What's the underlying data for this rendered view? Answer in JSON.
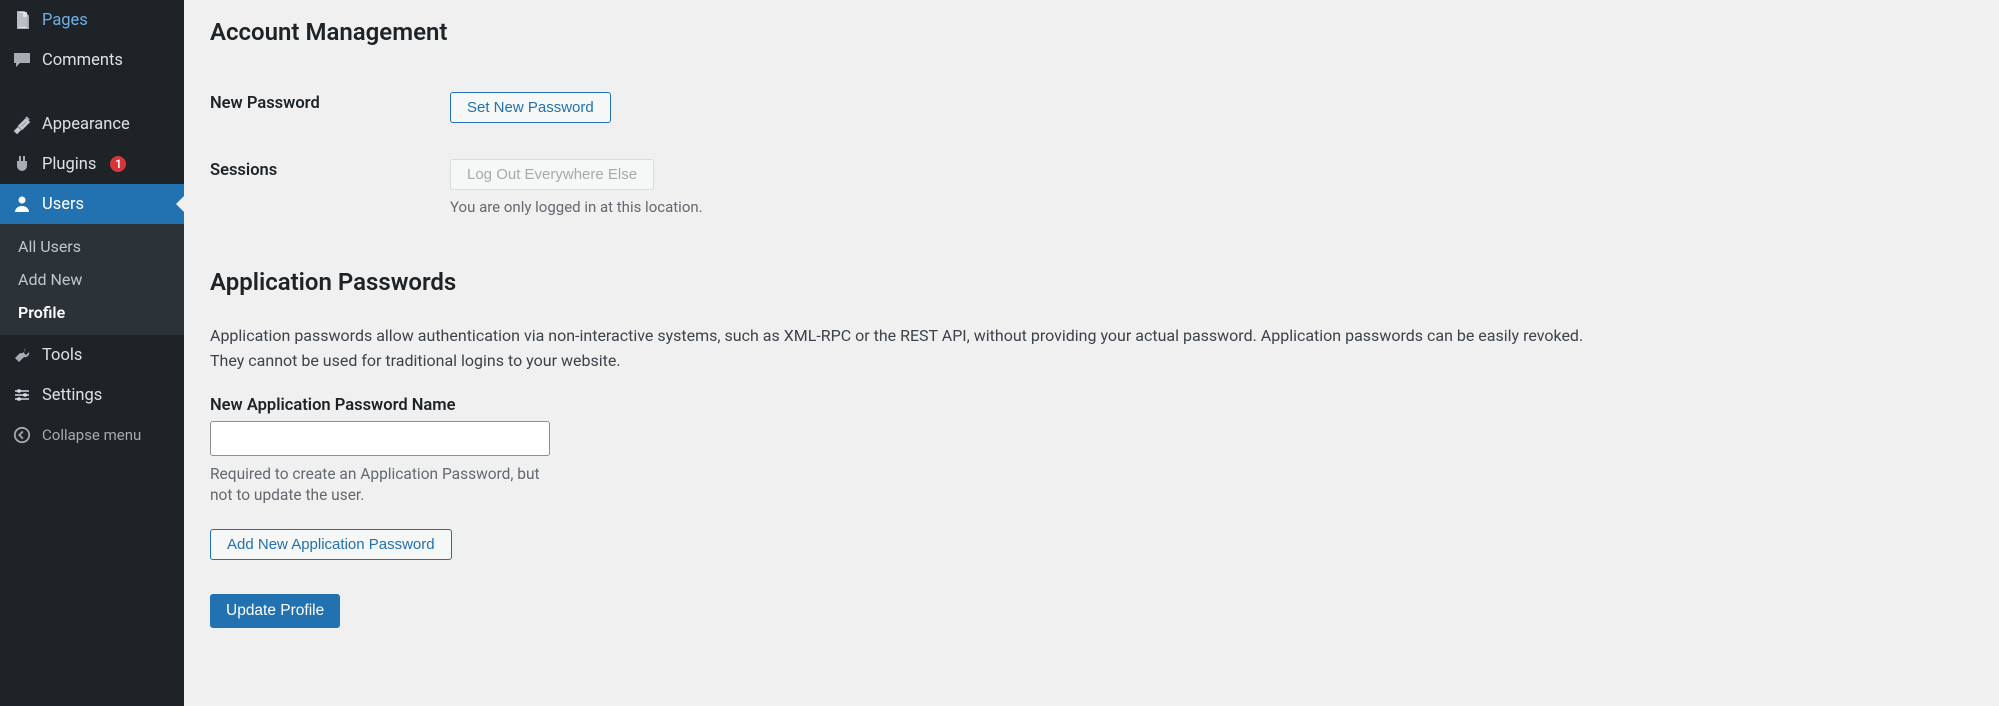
{
  "sidebar": {
    "items_top": [
      {
        "label": "Pages",
        "icon": "page"
      },
      {
        "label": "Comments",
        "icon": "comments"
      }
    ],
    "items_mid": [
      {
        "label": "Appearance",
        "icon": "appearance"
      },
      {
        "label": "Plugins",
        "icon": "plugins",
        "badge": "1"
      },
      {
        "label": "Users",
        "icon": "users",
        "active": true
      },
      {
        "label": "Tools",
        "icon": "tools"
      },
      {
        "label": "Settings",
        "icon": "settings"
      }
    ],
    "submenu": [
      {
        "label": "All Users"
      },
      {
        "label": "Add New"
      },
      {
        "label": "Profile",
        "current": true
      }
    ],
    "collapse_label": "Collapse menu"
  },
  "account": {
    "heading": "Account Management",
    "password_label": "New Password",
    "password_button": "Set New Password",
    "sessions_label": "Sessions",
    "sessions_button": "Log Out Everywhere Else",
    "sessions_desc": "You are only logged in at this location."
  },
  "app_pw": {
    "heading": "Application Passwords",
    "desc": "Application passwords allow authentication via non-interactive systems, such as XML-RPC or the REST API, without providing your actual password. Application passwords can be easily revoked. They cannot be used for traditional logins to your website.",
    "name_label": "New Application Password Name",
    "name_help": "Required to create an Application Password, but not to update the user.",
    "add_button": "Add New Application Password"
  },
  "submit_label": "Update Profile"
}
